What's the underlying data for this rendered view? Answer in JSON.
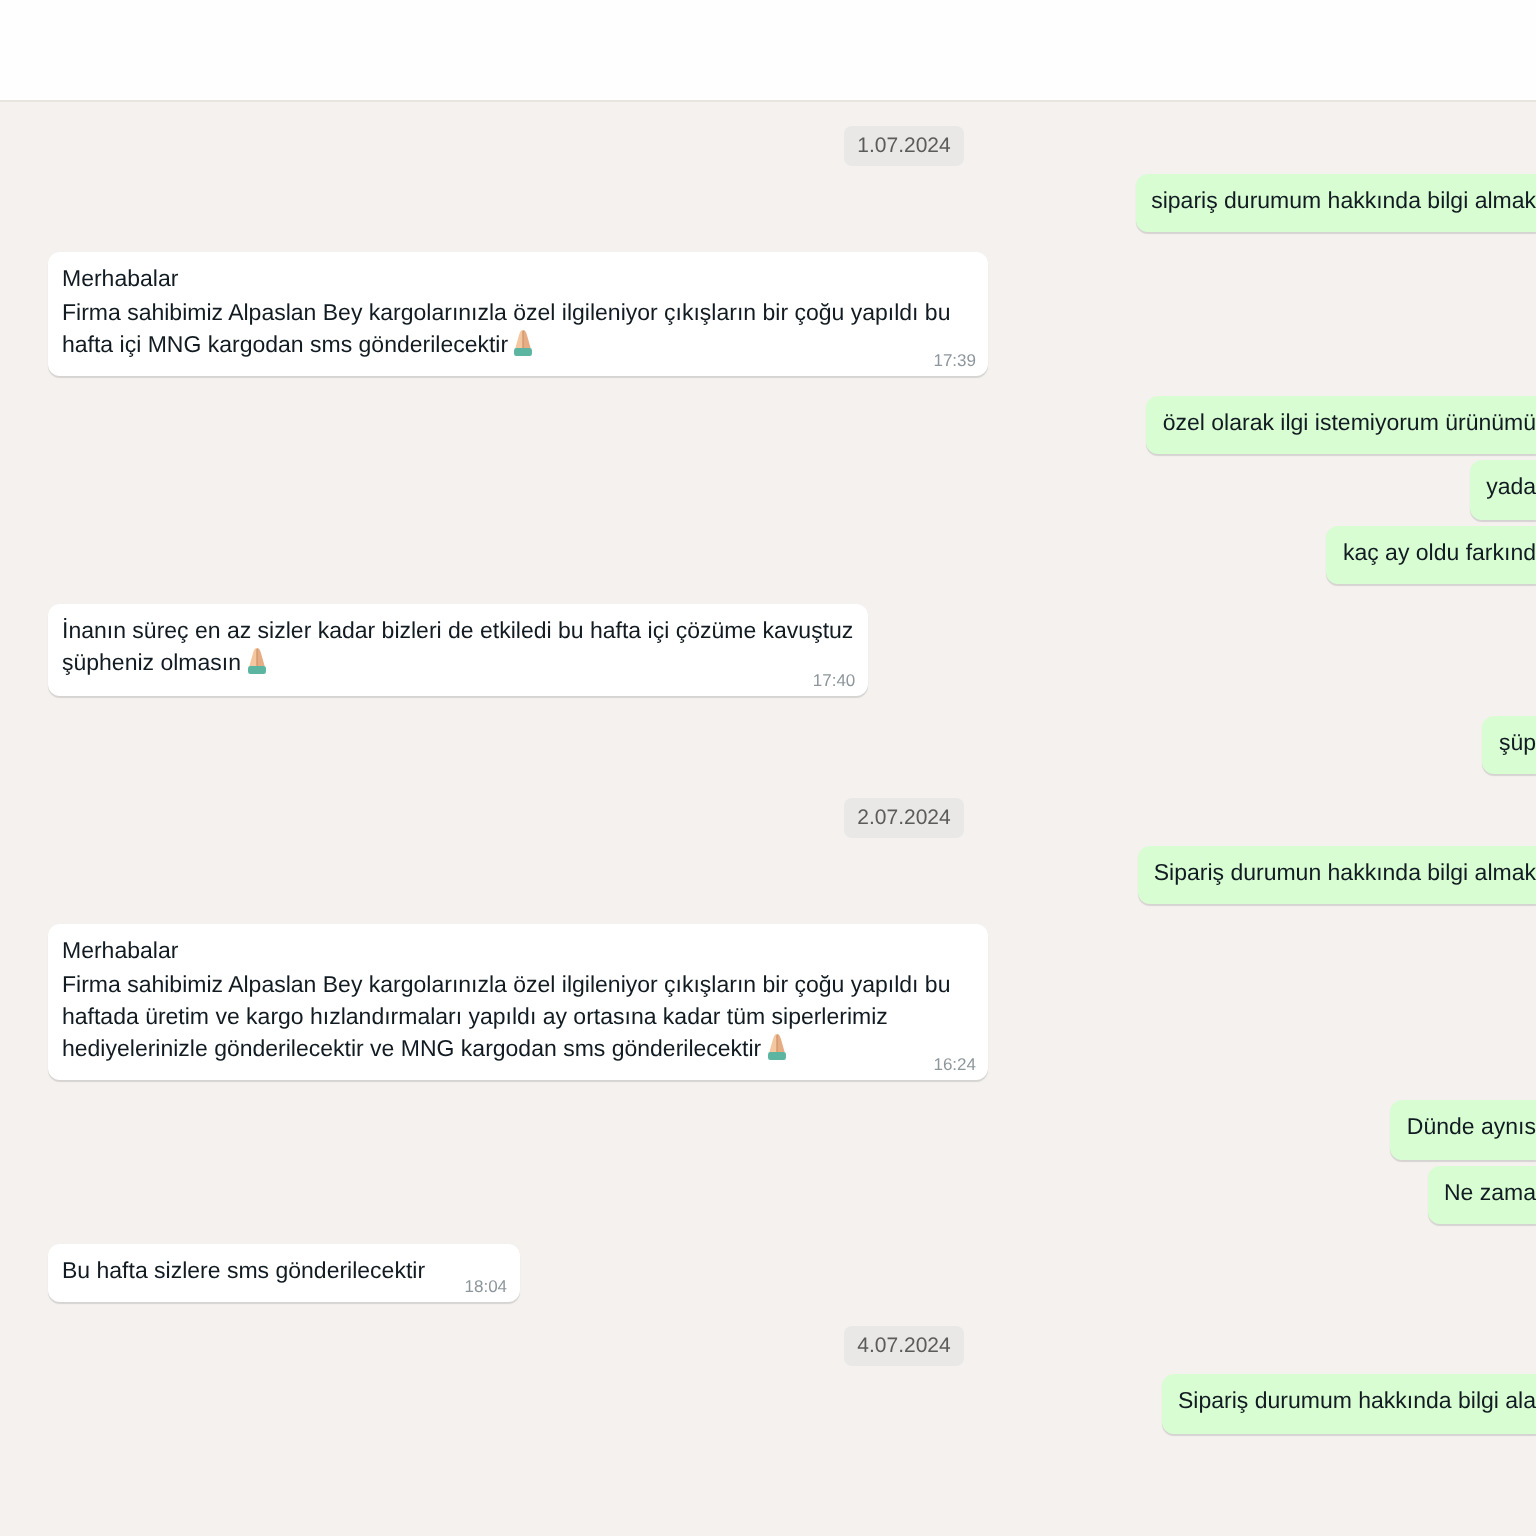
{
  "chat": {
    "items": [
      {
        "kind": "date",
        "text": "1.07.2024"
      },
      {
        "kind": "outgoing",
        "text": "sipariş durumum hakkında bilgi almak",
        "has_emoji": false
      },
      {
        "kind": "incoming",
        "text": "Merhabalar\nFirma sahibimiz Alpaslan Bey kargolarınızla özel ilgileniyor çıkışların bir çoğu yapıldı bu hafta içi MNG kargodan sms gönderilecektir",
        "time": "17:39",
        "has_emoji": true
      },
      {
        "kind": "outgoing",
        "text": "özel olarak ilgi istemiyorum ürünümü",
        "has_emoji": false
      },
      {
        "kind": "outgoing",
        "text": "yada",
        "has_emoji": false
      },
      {
        "kind": "outgoing",
        "text": "kaç ay oldu farkınd",
        "has_emoji": false
      },
      {
        "kind": "incoming",
        "text": "İnanın süreç en az sizler kadar bizleri de etkiledi bu hafta içi çözüme kavuştuz\nşüpheniz olmasın",
        "time": "17:40",
        "has_emoji": true
      },
      {
        "kind": "outgoing",
        "text": "şüp",
        "has_emoji": false
      },
      {
        "kind": "date",
        "text": "2.07.2024"
      },
      {
        "kind": "outgoing",
        "text": "Sipariş durumun hakkında bilgi almak",
        "has_emoji": false
      },
      {
        "kind": "incoming",
        "text": "Merhabalar\nFirma sahibimiz Alpaslan Bey kargolarınızla özel ilgileniyor çıkışların bir çoğu yapıldı bu haftada üretim ve kargo hızlandırmaları yapıldı ay ortasına kadar tüm siperlerimiz hediyelerinizle gönderilecektir ve MNG kargodan sms gönderilecektir",
        "time": "16:24",
        "has_emoji": true
      },
      {
        "kind": "outgoing",
        "text": "Dünde aynıs",
        "has_emoji": false
      },
      {
        "kind": "outgoing",
        "text": "Ne zama",
        "has_emoji": false
      },
      {
        "kind": "incoming",
        "text": "Bu hafta sizlere sms gönderilecektir",
        "time": "18:04",
        "has_emoji": false
      },
      {
        "kind": "date",
        "text": "4.07.2024"
      },
      {
        "kind": "outgoing",
        "text": "Sipariş durumum hakkında bilgi ala",
        "has_emoji": false
      }
    ]
  }
}
